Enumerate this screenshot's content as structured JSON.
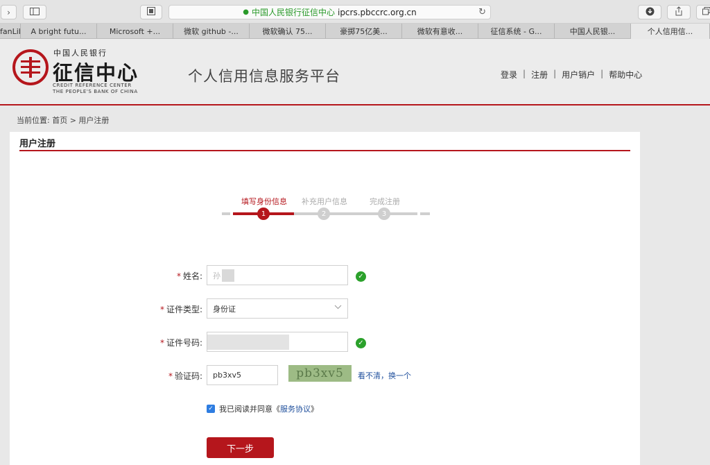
{
  "browser": {
    "site_name": "中国人民银行征信中心",
    "url": "ipcrs.pbccrc.org.cn",
    "nav_forward_icon": "chevron-right-icon",
    "sidebar_icon": "sidebar-icon",
    "reader_icon": "reader-icon",
    "reload_icon": "reload-icon",
    "download_icon": "download-icon",
    "share_icon": "share-icon",
    "tabs_icon": "tabs-icon",
    "tabs": [
      "fanLib",
      "A bright futu...",
      "Microsoft +...",
      "微软 github -...",
      "微软确认 75...",
      "豪掷75亿美...",
      "微软有意收...",
      "征信系统 - G...",
      "中国人民银...",
      "个人信用信..."
    ]
  },
  "header": {
    "logo_small": "中国人民银行",
    "logo_title": "征信中心",
    "logo_en_1": "CREDIT REFERENCE CENTER",
    "logo_en_2": "THE PEOPLE'S BANK OF CHINA",
    "platform_title": "个人信用信息服务平台",
    "links": {
      "login": "登录",
      "register": "注册",
      "cancel_account": "用户销户",
      "help": "帮助中心",
      "separator": "|"
    },
    "accent_color": "#b5161c"
  },
  "breadcrumb": {
    "text": "当前位置:  首页 > 用户注册"
  },
  "panel": {
    "title": "用户注册"
  },
  "stepper": {
    "steps": [
      {
        "label": "填写身份信息",
        "number": "1",
        "active": true
      },
      {
        "label": "补充用户信息",
        "number": "2",
        "active": false
      },
      {
        "label": "完成注册",
        "number": "3",
        "active": false
      }
    ]
  },
  "form": {
    "required_mark": "*",
    "name_label": "姓名:",
    "name_value_prefix": "孙",
    "id_type_label": "证件类型:",
    "id_type_value": "身份证",
    "id_number_label": "证件号码:",
    "captcha_label": "验证码:",
    "captcha_value": "pb3xv5",
    "captcha_image_text": "pb3xv5",
    "captcha_refresh": "看不清，换一个",
    "check_mark": "✓",
    "agree_prefix": "我已阅读并同意《",
    "agree_link": "服务协议",
    "agree_suffix": "》",
    "next_button": "下一步"
  }
}
